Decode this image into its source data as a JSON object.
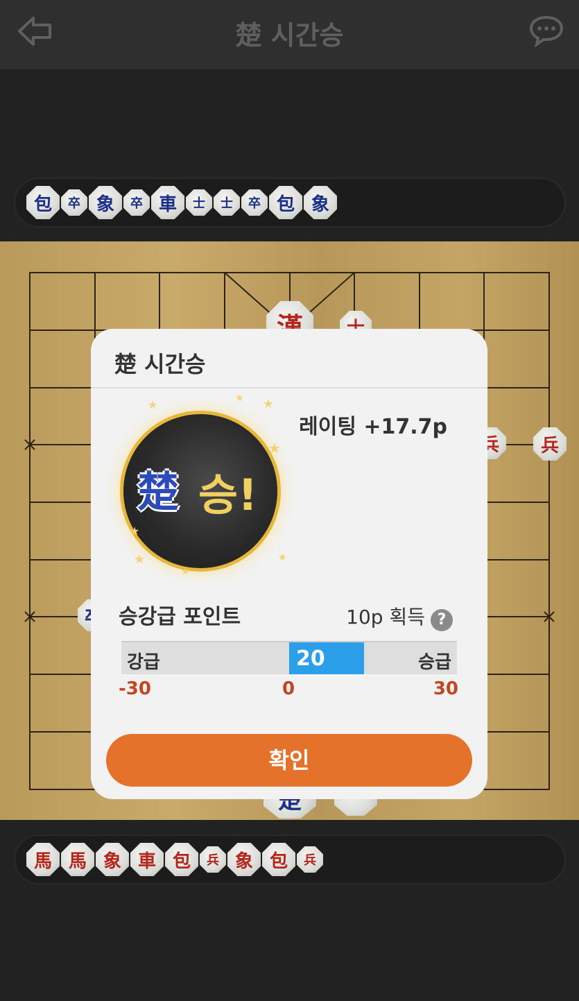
{
  "header": {
    "title": "楚 시간승",
    "back_icon": "back-arrow-icon",
    "chat_icon": "chat-bubble-icon"
  },
  "captured_top": [
    {
      "char": "包",
      "size": "big"
    },
    {
      "char": "卒",
      "size": "small"
    },
    {
      "char": "象",
      "size": "big"
    },
    {
      "char": "卒",
      "size": "small"
    },
    {
      "char": "車",
      "size": "big"
    },
    {
      "char": "士",
      "size": "small"
    },
    {
      "char": "士",
      "size": "small"
    },
    {
      "char": "卒",
      "size": "small"
    },
    {
      "char": "包",
      "size": "big"
    },
    {
      "char": "象",
      "size": "big"
    }
  ],
  "captured_bottom": [
    {
      "char": "馬",
      "size": "big"
    },
    {
      "char": "馬",
      "size": "big"
    },
    {
      "char": "象",
      "size": "big"
    },
    {
      "char": "車",
      "size": "big"
    },
    {
      "char": "包",
      "size": "big"
    },
    {
      "char": "兵",
      "size": "small"
    },
    {
      "char": "象",
      "size": "big"
    },
    {
      "char": "包",
      "size": "big"
    },
    {
      "char": "兵",
      "size": "small"
    }
  ],
  "board_pieces": {
    "red_king": "漢",
    "red_guard": "士",
    "red_soldier_1": "兵",
    "red_soldier_2": "兵",
    "blue_partial_1": "卒",
    "blue_partial_2": "楚"
  },
  "dialog": {
    "title": "楚 시간승",
    "rating": "레이팅 +17.7p",
    "emblem_mark": "楚",
    "emblem_text": "승!",
    "points_label": "승강급 포인트",
    "points_gain": "10p 획득",
    "help": "?",
    "bar": {
      "left_label": "강급",
      "right_label": "승급",
      "value_label": "20",
      "value": 20,
      "min": -30,
      "max": 30,
      "min_label": "-30",
      "mid_label": "0",
      "max_label": "30"
    },
    "confirm": "확인"
  },
  "colors": {
    "accent_orange": "#e5722a",
    "bar_blue": "#2b9fe9",
    "scale_red": "#c2461f",
    "blue_piece": "#1b2f86",
    "red_piece": "#b3261b"
  }
}
